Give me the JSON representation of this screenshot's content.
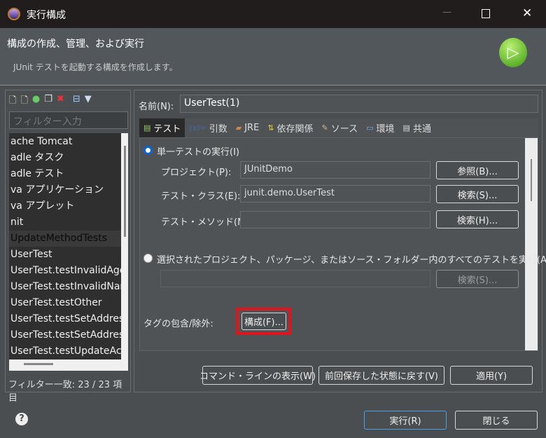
{
  "window": {
    "title": "実行構成",
    "minimize": "—",
    "maximize": "☐",
    "close": "✕"
  },
  "header": {
    "title": "構成の作成、管理、および実行",
    "subtitle": "JUnit テストを起動する構成を作成します。"
  },
  "left": {
    "filter_placeholder": "フィルター入力",
    "items": [
      "ache Tomcat",
      "adle タスク",
      "adle テスト",
      "va アプリケーション",
      "va アプレット",
      "nit",
      "UpdateMethodTests",
      "UserTest",
      "UserTest.testInvalidAge",
      "UserTest.testInvalidName",
      "UserTest.testOther",
      "UserTest.testSetAddress",
      "UserTest.testSetAddress",
      "UserTest.testUpdateAc"
    ],
    "selected_index": 6,
    "status": "フィルター一致: 23 / 23 項目"
  },
  "form": {
    "name_label": "名前(N):",
    "name_value": "UserTest(1)",
    "tabs": [
      "テスト",
      "引数",
      "JRE",
      "依存関係",
      "ソース",
      "環境",
      "共通"
    ],
    "single_test_label": "単一テストの実行(I)",
    "project_label": "プロジェクト(P):",
    "project_value": "JUnitDemo",
    "browse_label": "参照(B)...",
    "class_label": "テスト・クラス(E):",
    "class_value": "junit.demo.UserTest",
    "search_label": "検索(S)...",
    "method_label": "テスト・メソッド(M):",
    "method_value": "",
    "method_search_label": "検索(H)...",
    "all_tests_label": "選択されたプロジェクト、パッケージ、またはソース・フォルダー内のすべてのテストを実行(A):",
    "all_tests_value": "",
    "all_search_label": "検索(S)...",
    "tags_label": "タグの包含/除外:",
    "configure_label": "構成(F)..."
  },
  "actions": {
    "show_cmd": "コマンド・ラインの表示(W)",
    "revert": "前回保存した状態に戻す(V)",
    "apply": "適用(Y)"
  },
  "footer": {
    "help": "?",
    "run": "実行(R)",
    "close": "閉じる"
  },
  "colors": {
    "highlight": "#e0141c",
    "radio": "#0a64d8"
  }
}
